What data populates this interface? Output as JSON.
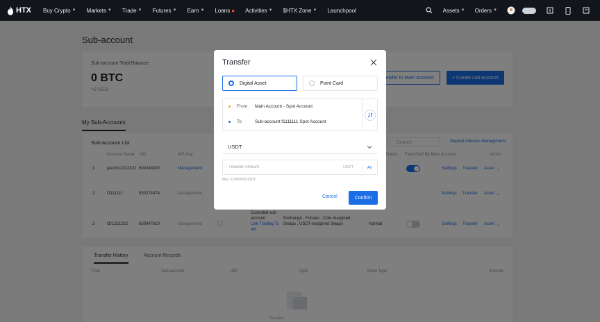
{
  "nav": {
    "logo": "HTX",
    "items": [
      "Buy Crypto",
      "Markets",
      "Trade",
      "Futures",
      "Earn",
      "Loans",
      "Activities",
      "$HTX Zone",
      "Launchpool"
    ],
    "right": [
      "Assets",
      "Orders"
    ]
  },
  "page": {
    "title": "Sub-account",
    "balance_label": "Sub-account Total Balance",
    "balance_value": "0 BTC",
    "balance_usd": "≈0 USD",
    "transfer_to_main": "Transfer to Main Account",
    "create_sub": "+  Create sub-account",
    "tab_my_subs": "My Sub-Accounts"
  },
  "list": {
    "title": "Sub-account List",
    "search_placeholder": "Search",
    "deposit_link": "Deposit Address Management",
    "columns": [
      "Account Name",
      "UID",
      "API Key",
      "Status",
      "Fees Paid By Main Account",
      "Action"
    ],
    "rows": [
      {
        "index": "1",
        "name": "jasonl12312322",
        "uid": "502048020",
        "api": "Management",
        "actions": [
          "Settings",
          "Transfer",
          "Asset"
        ]
      },
      {
        "index": "2",
        "name": "f1111111",
        "uid": "530274474",
        "api": "Management",
        "actions": [
          "Settings",
          "Transfer",
          "Asset"
        ]
      },
      {
        "index": "3",
        "name": "f1f1231232",
        "uid": "639047610",
        "api": "Management",
        "type_line1": "Custodial sub",
        "type_line2": "account",
        "type_link1": "Link Trading To",
        "type_link2": "am",
        "perm_line1": "Exchange , Futures , Coin-margined",
        "perm_line2": "Swaps , USDT-margined Swaps",
        "status": "Normal",
        "actions": [
          "Settings",
          "Transfer",
          "Asset"
        ]
      }
    ]
  },
  "history": {
    "tabs": [
      "Transfer History",
      "Account Records"
    ],
    "columns": [
      "Time",
      "Sub-account",
      "UID",
      "Type",
      "Asset Type",
      "Amount"
    ],
    "empty": "No data"
  },
  "modal": {
    "title": "Transfer",
    "opt_digital": "Digital Asset",
    "opt_point": "Point Card",
    "from_label": "From",
    "from_value": "Main Account - Spot Account",
    "to_label": "To",
    "to_value": "Sub-account f1111111 Spot Account",
    "coin": "USDT",
    "amount_placeholder": "Transfer Amount",
    "amount_unit": "USDT",
    "amount_all": "All",
    "max_text": "Max 0.0000000USDT",
    "cancel": "Cancel",
    "confirm": "Confirm"
  },
  "colors": {
    "primary": "#1b6ee6",
    "nav_bg": "#12161c",
    "from_dot": "#f5a623",
    "to_dot": "#1b6ee6"
  }
}
